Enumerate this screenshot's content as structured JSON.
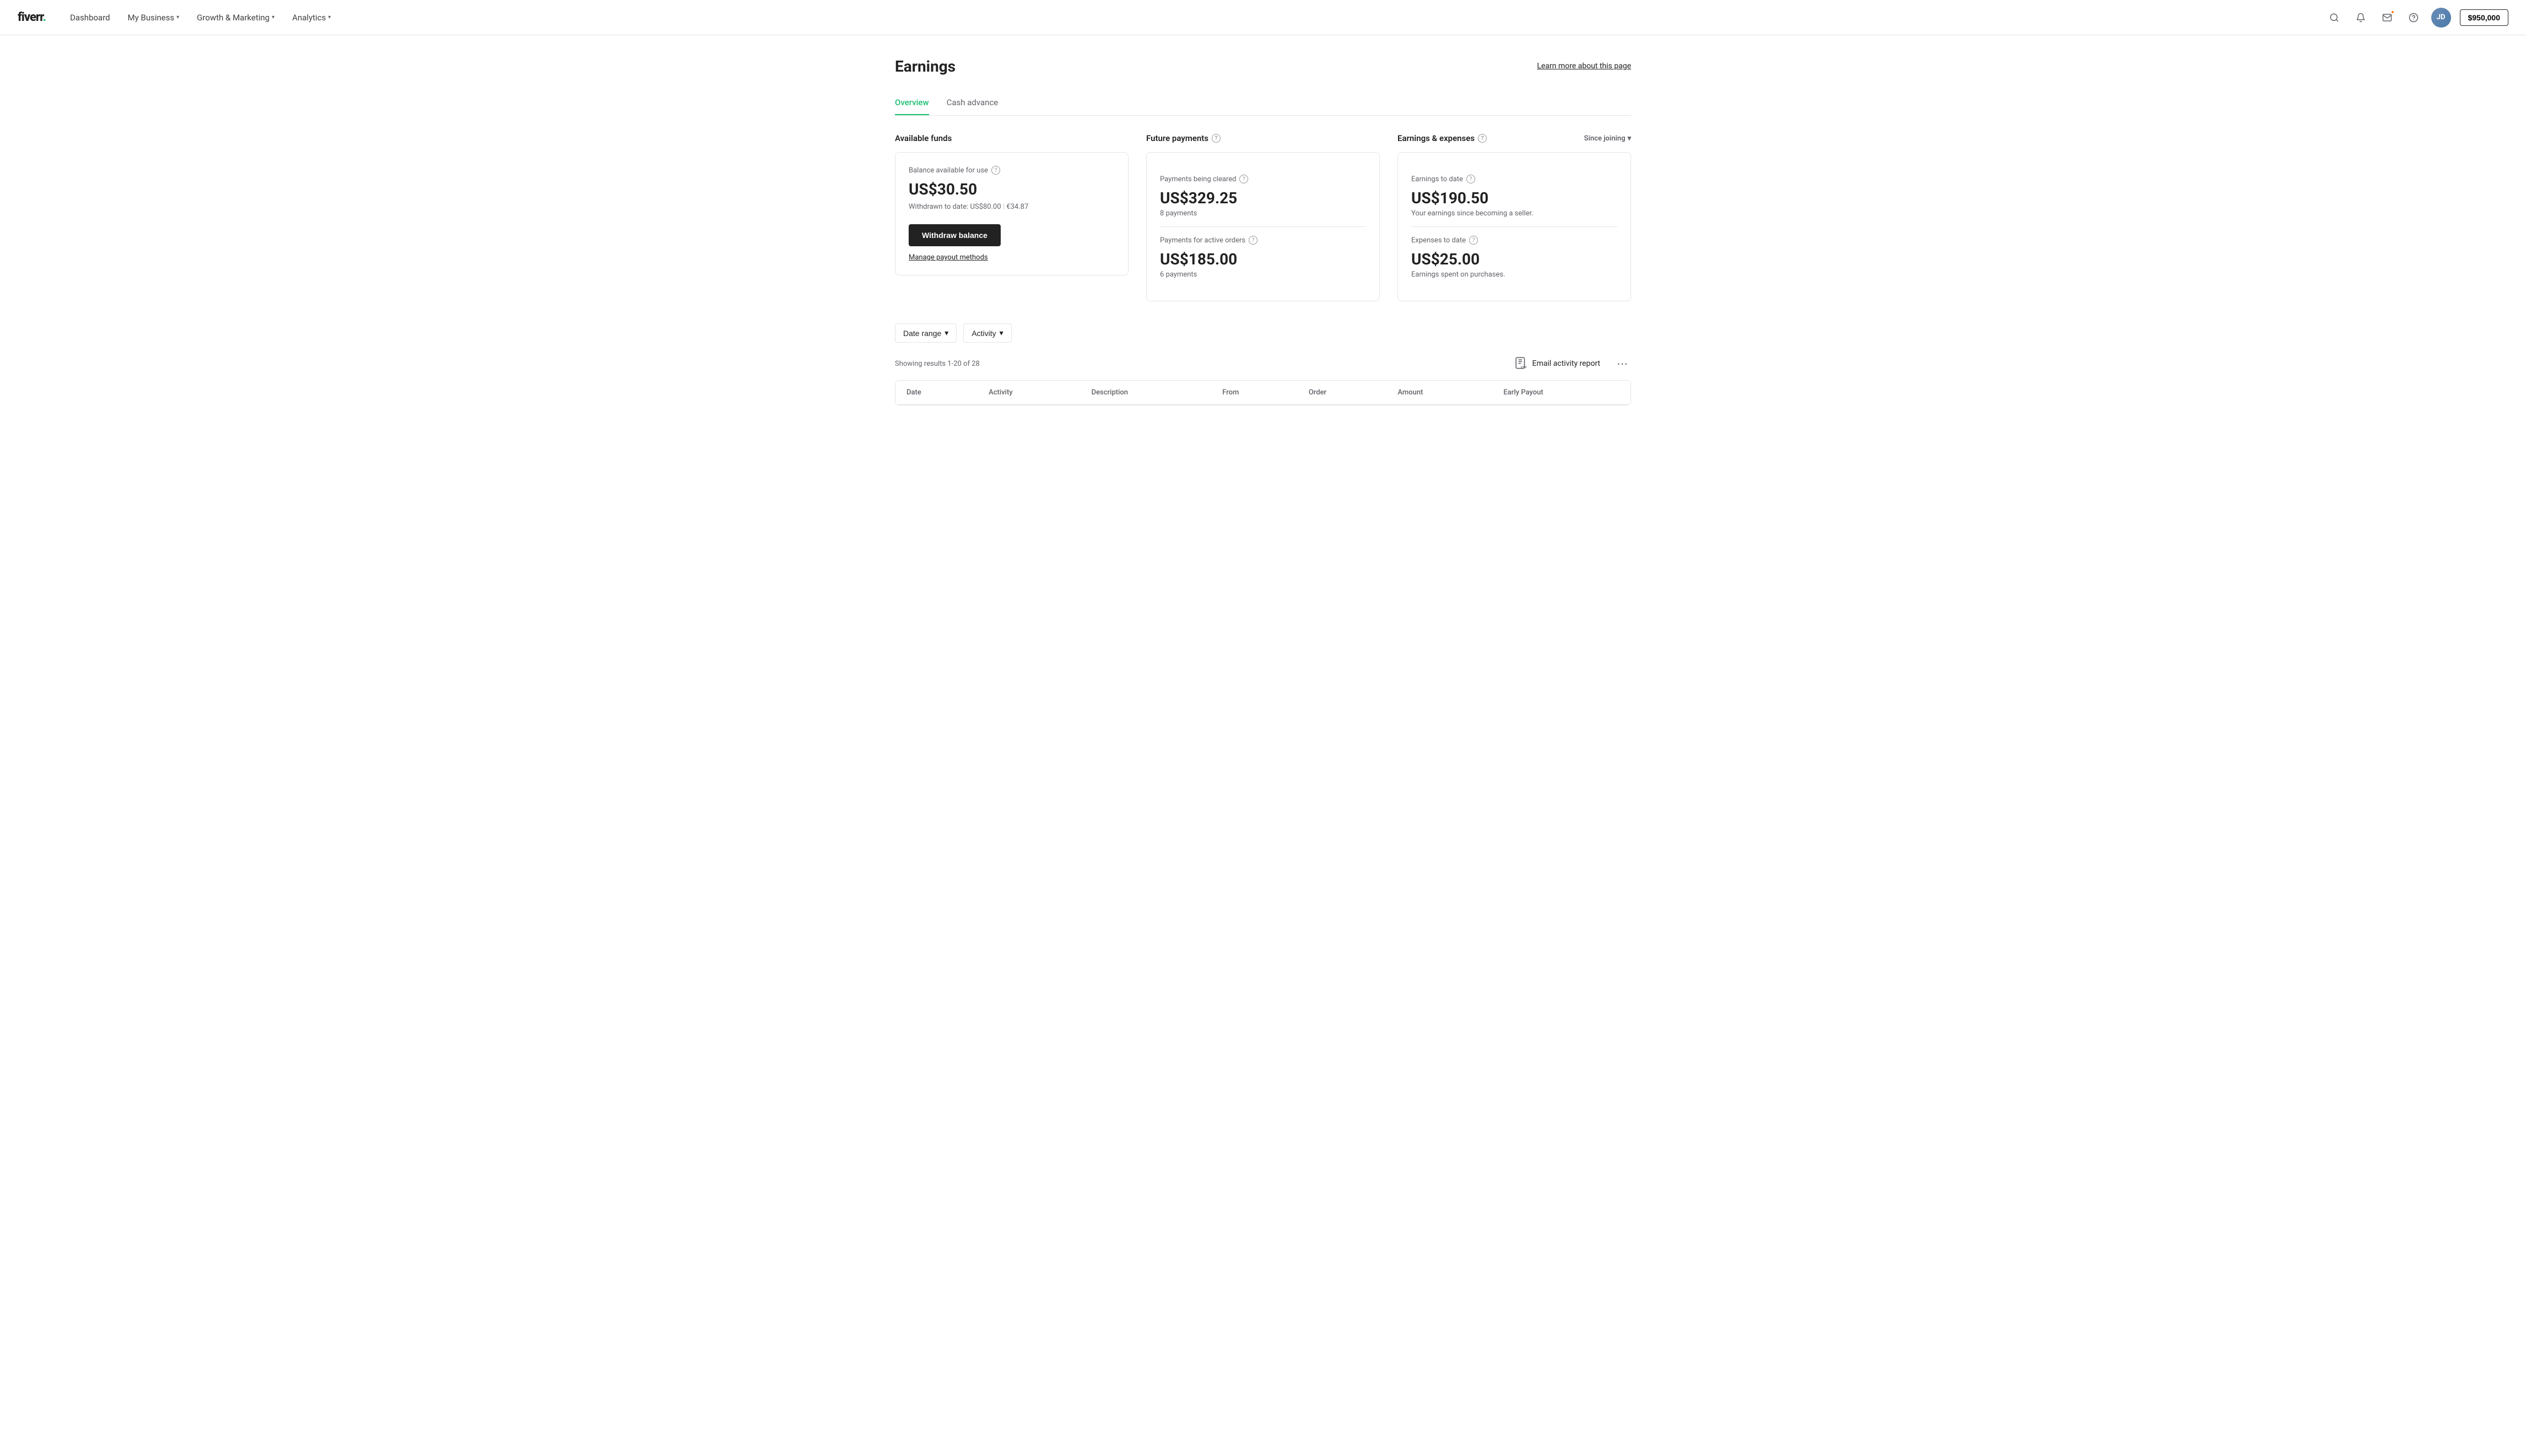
{
  "header": {
    "logo": "fiverr.",
    "nav": [
      {
        "label": "Dashboard",
        "hasDropdown": false
      },
      {
        "label": "My Business",
        "hasDropdown": true
      },
      {
        "label": "Growth & Marketing",
        "hasDropdown": true
      },
      {
        "label": "Analytics",
        "hasDropdown": true
      }
    ],
    "balance": "$950,000",
    "avatar_initials": "JD"
  },
  "page": {
    "title": "Earnings",
    "learn_more": "Learn more about this page",
    "tabs": [
      {
        "label": "Overview",
        "active": true
      },
      {
        "label": "Cash advance",
        "active": false
      }
    ]
  },
  "available_funds": {
    "section_label": "Available funds",
    "card": {
      "balance_label": "Balance available for use",
      "balance_amount": "US$30.50",
      "withdrawn_label": "Withdrawn to date:",
      "withdrawn_usd": "US$80.00",
      "withdrawn_eur": "€34.87",
      "withdraw_btn": "Withdraw balance",
      "manage_payout": "Manage payout methods"
    }
  },
  "future_payments": {
    "section_label": "Future payments",
    "clearing_label": "Payments being cleared",
    "clearing_amount": "US$329.25",
    "clearing_count": "8 payments",
    "active_label": "Payments for active orders",
    "active_amount": "US$185.00",
    "active_count": "6 payments"
  },
  "earnings_expenses": {
    "section_label": "Earnings & expenses",
    "since_joining": "Since joining",
    "earnings_label": "Earnings to date",
    "earnings_amount": "US$190.50",
    "earnings_sub": "Your earnings since becoming a seller.",
    "expenses_label": "Expenses to date",
    "expenses_amount": "US$25.00",
    "expenses_sub": "Earnings spent on purchases."
  },
  "filters": {
    "date_range": "Date range",
    "activity": "Activity"
  },
  "results": {
    "showing": "Showing results 1-20 of 28",
    "email_report": "Email activity report",
    "more": "···"
  },
  "table": {
    "columns": [
      "Date",
      "Activity",
      "Description",
      "From",
      "Order",
      "Amount",
      "Early Payout"
    ]
  },
  "colors": {
    "green": "#1dbf73",
    "dark": "#222",
    "gray": "#62646a",
    "border": "#e4e4e4"
  }
}
